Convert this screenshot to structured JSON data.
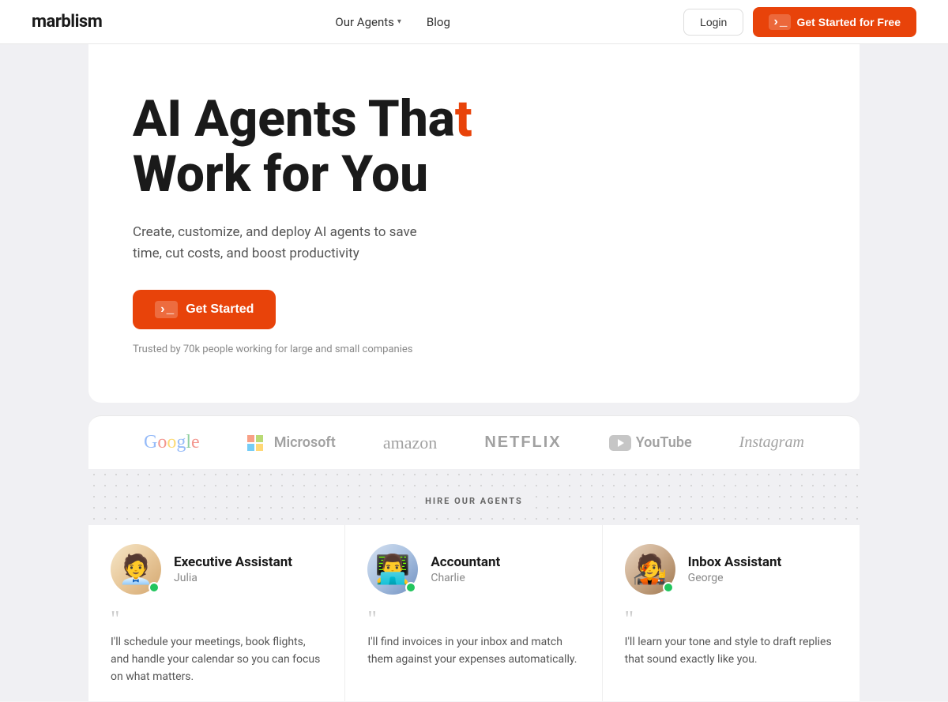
{
  "header": {
    "logo": "marblism",
    "nav": {
      "agents_label": "Our Agents",
      "blog_label": "Blog"
    },
    "login_label": "Login",
    "get_started_label": "Get Started for Free"
  },
  "hero": {
    "title_line1_plain": "AI Agents Tha",
    "title_line1_accent": "t",
    "title_line2": "Work for You",
    "subtitle": "Create, customize, and deploy AI agents to save time, cut costs, and boost productivity",
    "cta_label": "Get Started",
    "trust_text": "Trusted by 70k people working for large and small companies"
  },
  "brands": [
    {
      "name": "Google",
      "type": "google"
    },
    {
      "name": "Microsoft",
      "type": "microsoft"
    },
    {
      "name": "amazon",
      "type": "amazon"
    },
    {
      "name": "NETFLIX",
      "type": "netflix"
    },
    {
      "name": "YouTube",
      "type": "youtube"
    },
    {
      "name": "Instagram",
      "type": "instagram"
    }
  ],
  "hire_section": {
    "label": "HIRE OUR AGENTS"
  },
  "agents": [
    {
      "role": "Executive Assistant",
      "name": "Julia",
      "quote": "I'll schedule your meetings, book flights, and handle your calendar so you can focus on what matters."
    },
    {
      "role": "Accountant",
      "name": "Charlie",
      "quote": "I'll find invoices in your inbox and match them against your expenses automatically."
    },
    {
      "role": "Inbox Assistant",
      "name": "George",
      "quote": "I'll learn your tone and style to draft replies that sound exactly like you."
    }
  ]
}
